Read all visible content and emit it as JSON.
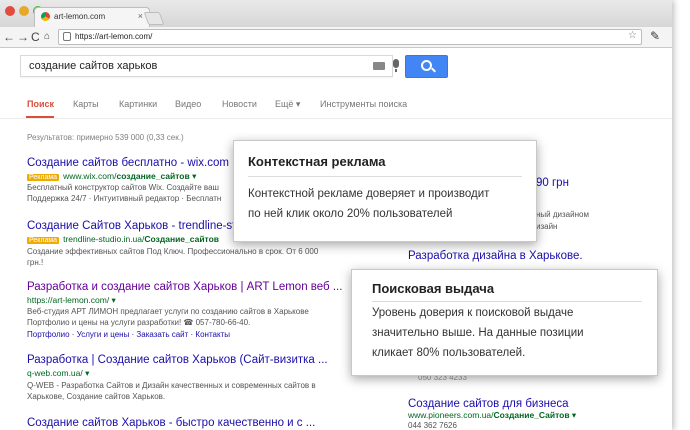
{
  "browser": {
    "tab_title": "art-lemon.com",
    "url": "https://art-lemon.com/"
  },
  "search": {
    "query": "создание сайтов харьков"
  },
  "nav": {
    "tabs": [
      "Поиск",
      "Карты",
      "Картинки",
      "Видео",
      "Новости",
      "Ещё ▾",
      "Инструменты поиска"
    ]
  },
  "stats": "Результатов: примерно 539 000 (0,33 сек.)",
  "results": [
    {
      "title": "Создание сайтов бесплатно - wix.com",
      "ad": "Реклама",
      "url_pre": "www.wix.com/",
      "url_bold": "создание_сайтов",
      "url_post": " ▾",
      "snippet1": "Бесплатный конструктор сайтов Wix. Создайте ваш",
      "snippet2": "Поддержка 24/7 · Интуитивный редактор · Бесплатн"
    },
    {
      "title": "Создание Сайтов Харьков - trendline-studio",
      "ad": "Реклама",
      "url_pre": "trendline-studio.in.ua/",
      "url_bold": "Создание_сайтов",
      "snippet1": "Создание эффективных сайтов Под Ключ. Профессионально в срок. От 6 000",
      "snippet2": "грн.!"
    },
    {
      "title": "Разработка и создание сайтов Харьков | ART Lemon веб ...",
      "url": "https://art-lemon.com/ ▾",
      "snippet1": "Веб-студия АРТ ЛИМОН предлагает услуги по созданию сайтов в Харькове",
      "snippet2": "Портфолио и цены на услуги разработки! ☎ 057-780-66-40.",
      "links": "Портфолио · Услуги и цены · Заказать сайт · Контакты"
    },
    {
      "title": "Разработка | Создание сайтов Харьков (Сайт-визитка ...",
      "url": "q-web.com.ua/ ▾",
      "snippet1": "Q-WEB - Разработка Сайтов и Дизайн качественных и современных сайтов в",
      "snippet2": "Харькове, Создание сайтов Харьков."
    },
    {
      "title": "Создание сайтов Харьков - быстро качественно и с ..."
    }
  ],
  "right_column": {
    "price": "90 грн",
    "snip_a": "ный дизайном",
    "snip_b": "изайн",
    "title1": "Разработка дизайна в Харькове.",
    "phone_partial": "050 323 4233",
    "title2": "Создание сайтов для бизнеса",
    "url_pre": "www.pioneers.com.ua/",
    "url_bold": "Создание_Сайтов",
    "url_post": " ▾",
    "phone": "044 362 7626"
  },
  "callouts": [
    {
      "title": "Контекстная реклама",
      "line1": "Контекстной рекламе доверяет и производит",
      "line2": "по ней клик около 20% пользователей"
    },
    {
      "title": "Поисковая выдача",
      "line1": "Уровень доверия к поисковой выдаче",
      "line2": "значительно выше. На данные позиции",
      "line3": "кликает 80% пользователей."
    }
  ],
  "colors": {
    "link": "#1a0dab",
    "url_green": "#006621",
    "ad_badge": "#f0ab00",
    "active_tab": "#dd4b39",
    "search_button": "#4285f4"
  },
  "icons": [
    "close-traffic-light-icon",
    "minimize-traffic-light-icon",
    "zoom-traffic-light-icon",
    "back-arrow-icon",
    "forward-arrow-icon",
    "reload-icon",
    "search-icon",
    "lock-icon",
    "star-icon",
    "wrench-icon",
    "keyboard-icon",
    "microphone-icon"
  ]
}
